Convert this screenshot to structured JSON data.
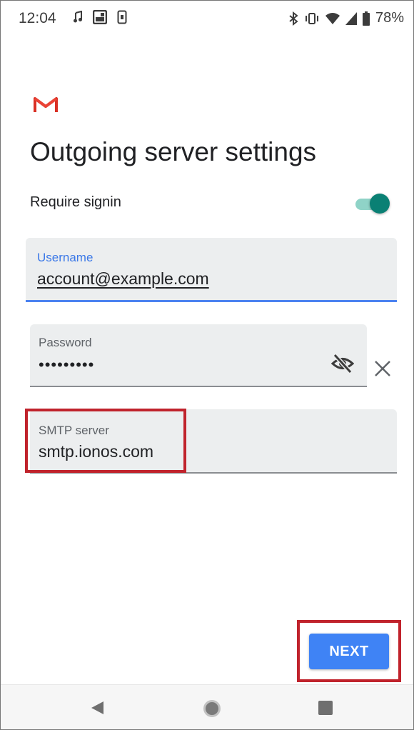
{
  "status_bar": {
    "time": "12:04",
    "battery_percent": "78%",
    "icons_left": [
      "music-note-icon",
      "image-icon",
      "phone-icon"
    ],
    "icons_right": [
      "bluetooth-icon",
      "vibrate-icon",
      "wifi-icon",
      "signal-icon",
      "battery-icon"
    ]
  },
  "app": {
    "logo": "gmail-logo-icon",
    "title": "Outgoing server settings"
  },
  "require_signin": {
    "label": "Require signin",
    "enabled": true
  },
  "fields": {
    "username": {
      "label": "Username",
      "value": "account@example.com"
    },
    "password": {
      "label": "Password",
      "value": "•••••••••"
    },
    "smtp": {
      "label": "SMTP server",
      "value": "smtp.ionos.com"
    }
  },
  "actions": {
    "next_label": "NEXT"
  },
  "colors": {
    "accent_blue": "#3f83f5",
    "toggle_teal": "#0a8074",
    "highlight_red": "#c0232c",
    "gmail_red": "#d93025"
  }
}
